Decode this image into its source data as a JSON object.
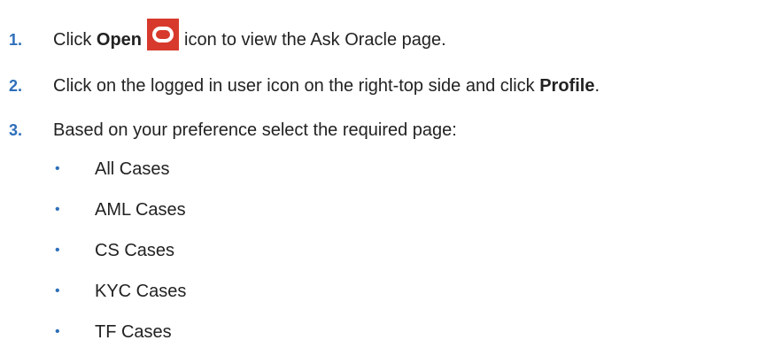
{
  "steps": [
    {
      "number": "1.",
      "prefix": "Click ",
      "bold": "Open",
      "icon": "open-icon",
      "suffix": "icon to view the Ask Oracle page."
    },
    {
      "number": "2.",
      "prefix": "Click on the logged in user icon on the right-top side and click ",
      "bold": "Profile",
      "suffix": "."
    },
    {
      "number": "3.",
      "prefix": "Based on your preference select the required page:"
    }
  ],
  "options": [
    "All Cases",
    "AML Cases",
    "CS Cases",
    "KYC Cases",
    "TF Cases"
  ],
  "colors": {
    "number_color": "#2e6fba",
    "icon_bg": "#d73a2c",
    "text": "#222222"
  }
}
